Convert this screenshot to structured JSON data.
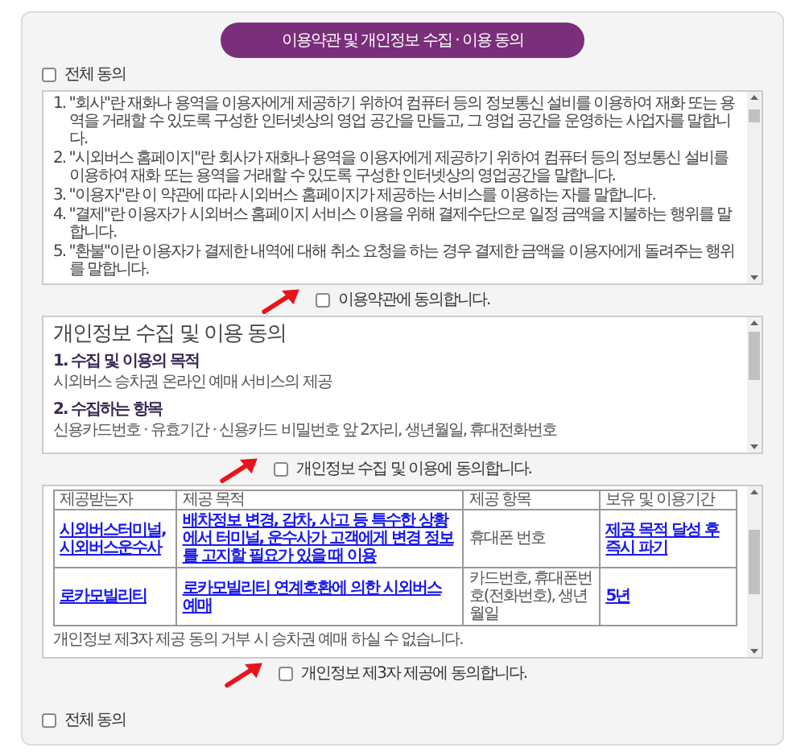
{
  "title": "이용약관 및 개인정보 수집 · 이용 동의",
  "agree_all_top": {
    "label": "전체 동의",
    "checked": false
  },
  "sections": [
    {
      "kind": "terms",
      "items": [
        "1. \"회사\"란 재화나 용역을 이용자에게 제공하기 위하여 컴퓨터 등의 정보통신 설비를 이용하여 재화 또는 용역을 거래할 수 있도록 구성한 인터넷상의 영업 공간을 만들고, 그 영업 공간을 운영하는 사업자를 말합니다.",
        "2. \"시외버스 홈페이지\"란 회사가 재화나 용역을 이용자에게 제공하기 위하여 컴퓨터 등의 정보통신 설비를 이용하여 재화 또는 용역을 거래할 수 있도록 구성한 인터넷상의 영업공간을 말합니다.",
        "3. \"이용자\"란 이 약관에 따라 시외버스 홈페이지가 제공하는 서비스를 이용하는 자를 말합니다.",
        "4. \"결제\"란 이용자가 시외버스 홈페이지 서비스 이용을 위해 결제수단으로 일정 금액을 지불하는 행위를 말합니다.",
        "5. \"환불\"이란 이용자가 결제한 내역에 대해 취소 요청을 하는 경우 결제한 금액을 이용자에게 돌려주는 행위를 말합니다."
      ],
      "agree": {
        "label": "이용약관에 동의합니다.",
        "checked": false
      }
    },
    {
      "kind": "privacy",
      "heading": "개인정보 수집 및 이용 동의",
      "blocks": [
        {
          "title": "1. 수집 및 이용의 목적",
          "text": "시외버스 승차권 온라인 예매 서비스의 제공"
        },
        {
          "title": "2. 수집하는 항목",
          "text": "신용카드번호 · 유효기간 · 신용카드 비밀번호 앞 2자리, 생년월일, 휴대전화번호"
        }
      ],
      "agree": {
        "label": "개인정보 수집 및 이용에 동의합니다.",
        "checked": false
      }
    },
    {
      "kind": "thirdparty",
      "columns": [
        "제공받는자",
        "제공 목적",
        "제공 항목",
        "보유 및 이용기간"
      ],
      "rows": [
        {
          "cells": [
            {
              "text": "시외버스터미널, 시외버스운수사",
              "link": true
            },
            {
              "text": "배차정보 변경, 감차, 사고 등 특수한 상황에서 터미널, 운수사가 고객에게 변경 정보를 고지할 필요가 있을 때 이용",
              "link": true
            },
            {
              "text": "휴대폰 번호",
              "link": false
            },
            {
              "text": "제공 목적 달성 후 즉시 파기",
              "link": true
            }
          ]
        },
        {
          "cells": [
            {
              "text": "로카모빌리티",
              "link": true
            },
            {
              "text": "로카모빌리티 연계호환에 의한 시외버스 예매",
              "link": true
            },
            {
              "text": "카드번호, 휴대폰번호(전화번호), 생년월일",
              "link": false
            },
            {
              "text": "5년",
              "link": true
            }
          ]
        }
      ],
      "note": "개인정보 제3자 제공 동의 거부 시 승차권 예매 하실 수 없습니다.",
      "agree": {
        "label": "개인정보 제3자 제공에 동의합니다.",
        "checked": false
      }
    }
  ],
  "agree_all_bottom": {
    "label": "전체 동의",
    "checked": false
  }
}
